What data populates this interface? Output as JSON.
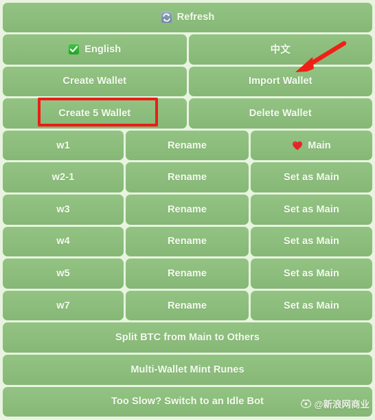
{
  "theme": {
    "page_bg": "#e8f4e0",
    "key_bg": "#8cbd7c",
    "key_text": "#f4faf0",
    "highlight": "#ed1c16",
    "arrow": "#ee2117"
  },
  "toolbar": {
    "refresh_label": "Refresh",
    "refresh_icon": "refresh-icon"
  },
  "language": {
    "english_label": "English",
    "english_icon": "check-mark-icon",
    "chinese_label": "中文"
  },
  "wallet_actions": {
    "create_wallet": "Create Wallet",
    "import_wallet": "Import Wallet",
    "create_5_wallet": "Create 5 Wallet",
    "delete_wallet": "Delete Wallet"
  },
  "wallet_list": {
    "rename_label": "Rename",
    "set_as_main_label": "Set as Main",
    "main_label": "Main",
    "main_icon": "heart-icon",
    "rows": [
      {
        "name": "w1",
        "rename": "Rename",
        "status": "Main",
        "is_main": true
      },
      {
        "name": "w2-1",
        "rename": "Rename",
        "status": "Set as Main",
        "is_main": false
      },
      {
        "name": "w3",
        "rename": "Rename",
        "status": "Set as Main",
        "is_main": false
      },
      {
        "name": "w4",
        "rename": "Rename",
        "status": "Set as Main",
        "is_main": false
      },
      {
        "name": "w5",
        "rename": "Rename",
        "status": "Set as Main",
        "is_main": false
      },
      {
        "name": "w7",
        "rename": "Rename",
        "status": "Set as Main",
        "is_main": false
      }
    ]
  },
  "bottom_actions": {
    "split_btc": "Split BTC from Main to Others",
    "multi_wallet_mint": "Multi-Wallet Mint Runes",
    "idle_bot": "Too Slow? Switch to an Idle Bot"
  },
  "annotations": {
    "highlight_target": "Create 5 Wallet",
    "arrow_target": "Import Wallet"
  },
  "watermark": {
    "text": "@新浪网商业",
    "logo": "sina-weibo-eye-icon"
  }
}
